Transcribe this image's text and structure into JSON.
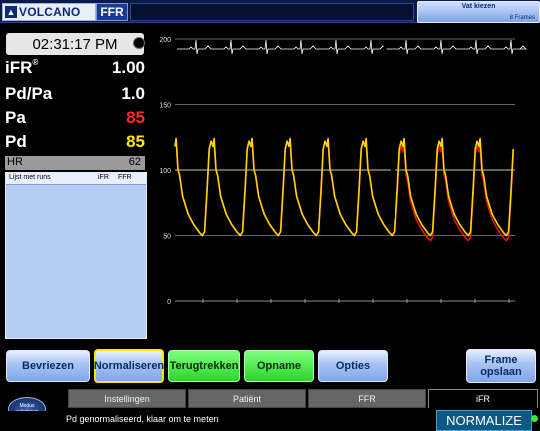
{
  "header": {
    "brand": "VOLCANO",
    "mode_badge": "FFR",
    "vessel_button": {
      "label": "Vat kiezen",
      "sub": "8 Frames"
    }
  },
  "clock": "02:31:17 PM",
  "measurements": {
    "ifr": {
      "label": "iFR",
      "sup": "®",
      "value": "1.00"
    },
    "pdpa": {
      "label": "Pd/Pa",
      "value": "1.0"
    },
    "pa": {
      "label": "Pa",
      "value": "85"
    },
    "pd": {
      "label": "Pd",
      "value": "85"
    }
  },
  "hr": {
    "label": "HR",
    "value": "62"
  },
  "runs": {
    "title": "Lijst met runs",
    "col_ifr": "iFR",
    "col_ffr": "FFR"
  },
  "chart": {
    "ticks": [
      "200",
      "150",
      "100",
      "50",
      "0"
    ]
  },
  "buttons": {
    "freeze": "Bevriezen",
    "normalize": "Normaliseren",
    "pullback": "Terugtrekken",
    "record": "Opname",
    "options": "Opties",
    "save_frame_1": "Frame",
    "save_frame_2": "opslaan"
  },
  "mode_select": {
    "line1": "Modus",
    "line2": "selecteren"
  },
  "tabs": [
    "Instellingen",
    "Patiënt",
    "FFR",
    "iFR"
  ],
  "status": {
    "message": "Pd genormaliseerd, klaar om te meten",
    "badge": "NORMALIZE"
  },
  "colors": {
    "pa_value": "#ff2a2a",
    "pd_value": "#ffe800",
    "pa_trace": "#e01414",
    "pd_trace": "#ffd400"
  }
}
